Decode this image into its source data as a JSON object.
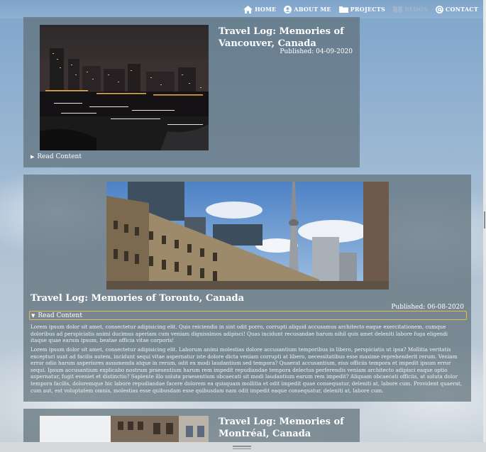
{
  "nav": {
    "items": [
      {
        "label": "HOME",
        "icon": "home-icon"
      },
      {
        "label": "ABOUT ME",
        "icon": "user-icon"
      },
      {
        "label": "PROJECTS",
        "icon": "folder-icon"
      },
      {
        "label": "BLOGS",
        "icon": "book-icon"
      },
      {
        "label": "CONTACT",
        "icon": "at-icon"
      }
    ]
  },
  "posts": [
    {
      "title": "Travel Log: Memories of Vancouver, Canada",
      "published": "Published: 04-09-2020",
      "summary": "Read Content",
      "expanded": false
    },
    {
      "title": "Travel Log: Memories of Toronto, Canada",
      "published": "Published: 06-08-2020",
      "summary": "Read Content",
      "expanded": true,
      "paragraph1": "Lorem ipsum dolor sit amet, consectetur adipisicing elit. Quis reiciendis in sint odit porro, corrupti aliquid accusamus architecto eaque exercitationem, cumque doloribus ad perspiciatis animi ducimus aperiam cum veniam dignissimos adipisci! Quas incidunt recusandae harum nihil quis amet deleniti labore fuga eligendi itaque quae earum ipsum, beatae officia vitae corporis!",
      "paragraph2": "Lorem ipsum dolor sit amet, consectetur adipisicing elit. Laborum animi molestias dolore accusantium temporibus in libero, perspiciatis ut ipsa? Mollitia veritatis excepturi sunt ad facilis autem, incidunt sequi vitae aspernatur iste dolore dicta veniam corrupti at libero, necessitatibus esse maxime reprehenderit rerum. Veniam error odio harum asperiores assumenda atque in rerum, odit ex modi laudantium sed tempora? Quaerat accusantium, eius officiis tempora et impedit ipsum error sequi. Ipsum accusantium explicabo nostrum praesentium harum rem impedit repudiandae tempora delectus perferendis veniam architecto adipisci eaque optio aspernatur, fugit eveniet et distinctio? Sapiente illo soluta praesentium obcaecati sit modi laudantium earum rem impedit? Aliquam obcaecati officiis, at soluta dolor tempora facilis, doloremque hic labore repudiandae facere dolorem ea quisquam mollitia et odit impedit quae consequatur, deleniti at, labore cum. Provident quaerat, cum aut, est voluptatem omnis, molestias esse quibusdam esse quibusdam nam odit impedit eaque consequatur, deleniti at, labore cum."
    },
    {
      "title": "Travel Log: Memories of Montréal, Canada"
    }
  ],
  "colors": {
    "card": "#60707a",
    "focus_outline": "#e8b84a",
    "sky": "#8fb0d2"
  }
}
